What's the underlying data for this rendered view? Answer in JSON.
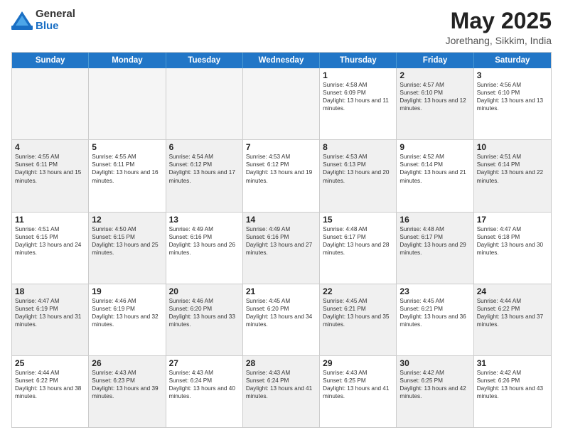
{
  "logo": {
    "general": "General",
    "blue": "Blue"
  },
  "header": {
    "month": "May 2025",
    "location": "Jorethang, Sikkim, India"
  },
  "days_of_week": [
    "Sunday",
    "Monday",
    "Tuesday",
    "Wednesday",
    "Thursday",
    "Friday",
    "Saturday"
  ],
  "weeks": [
    [
      {
        "day": "",
        "empty": true
      },
      {
        "day": "",
        "empty": true
      },
      {
        "day": "",
        "empty": true
      },
      {
        "day": "",
        "empty": true
      },
      {
        "day": "1",
        "sunrise": "Sunrise: 4:58 AM",
        "sunset": "Sunset: 6:09 PM",
        "daylight": "Daylight: 13 hours and 11 minutes."
      },
      {
        "day": "2",
        "sunrise": "Sunrise: 4:57 AM",
        "sunset": "Sunset: 6:10 PM",
        "daylight": "Daylight: 13 hours and 12 minutes.",
        "shaded": true
      },
      {
        "day": "3",
        "sunrise": "Sunrise: 4:56 AM",
        "sunset": "Sunset: 6:10 PM",
        "daylight": "Daylight: 13 hours and 13 minutes."
      }
    ],
    [
      {
        "day": "4",
        "sunrise": "Sunrise: 4:55 AM",
        "sunset": "Sunset: 6:11 PM",
        "daylight": "Daylight: 13 hours and 15 minutes.",
        "shaded": true
      },
      {
        "day": "5",
        "sunrise": "Sunrise: 4:55 AM",
        "sunset": "Sunset: 6:11 PM",
        "daylight": "Daylight: 13 hours and 16 minutes."
      },
      {
        "day": "6",
        "sunrise": "Sunrise: 4:54 AM",
        "sunset": "Sunset: 6:12 PM",
        "daylight": "Daylight: 13 hours and 17 minutes.",
        "shaded": true
      },
      {
        "day": "7",
        "sunrise": "Sunrise: 4:53 AM",
        "sunset": "Sunset: 6:12 PM",
        "daylight": "Daylight: 13 hours and 19 minutes."
      },
      {
        "day": "8",
        "sunrise": "Sunrise: 4:53 AM",
        "sunset": "Sunset: 6:13 PM",
        "daylight": "Daylight: 13 hours and 20 minutes.",
        "shaded": true
      },
      {
        "day": "9",
        "sunrise": "Sunrise: 4:52 AM",
        "sunset": "Sunset: 6:14 PM",
        "daylight": "Daylight: 13 hours and 21 minutes."
      },
      {
        "day": "10",
        "sunrise": "Sunrise: 4:51 AM",
        "sunset": "Sunset: 6:14 PM",
        "daylight": "Daylight: 13 hours and 22 minutes.",
        "shaded": true
      }
    ],
    [
      {
        "day": "11",
        "sunrise": "Sunrise: 4:51 AM",
        "sunset": "Sunset: 6:15 PM",
        "daylight": "Daylight: 13 hours and 24 minutes."
      },
      {
        "day": "12",
        "sunrise": "Sunrise: 4:50 AM",
        "sunset": "Sunset: 6:15 PM",
        "daylight": "Daylight: 13 hours and 25 minutes.",
        "shaded": true
      },
      {
        "day": "13",
        "sunrise": "Sunrise: 4:49 AM",
        "sunset": "Sunset: 6:16 PM",
        "daylight": "Daylight: 13 hours and 26 minutes."
      },
      {
        "day": "14",
        "sunrise": "Sunrise: 4:49 AM",
        "sunset": "Sunset: 6:16 PM",
        "daylight": "Daylight: 13 hours and 27 minutes.",
        "shaded": true
      },
      {
        "day": "15",
        "sunrise": "Sunrise: 4:48 AM",
        "sunset": "Sunset: 6:17 PM",
        "daylight": "Daylight: 13 hours and 28 minutes."
      },
      {
        "day": "16",
        "sunrise": "Sunrise: 4:48 AM",
        "sunset": "Sunset: 6:17 PM",
        "daylight": "Daylight: 13 hours and 29 minutes.",
        "shaded": true
      },
      {
        "day": "17",
        "sunrise": "Sunrise: 4:47 AM",
        "sunset": "Sunset: 6:18 PM",
        "daylight": "Daylight: 13 hours and 30 minutes."
      }
    ],
    [
      {
        "day": "18",
        "sunrise": "Sunrise: 4:47 AM",
        "sunset": "Sunset: 6:19 PM",
        "daylight": "Daylight: 13 hours and 31 minutes.",
        "shaded": true
      },
      {
        "day": "19",
        "sunrise": "Sunrise: 4:46 AM",
        "sunset": "Sunset: 6:19 PM",
        "daylight": "Daylight: 13 hours and 32 minutes."
      },
      {
        "day": "20",
        "sunrise": "Sunrise: 4:46 AM",
        "sunset": "Sunset: 6:20 PM",
        "daylight": "Daylight: 13 hours and 33 minutes.",
        "shaded": true
      },
      {
        "day": "21",
        "sunrise": "Sunrise: 4:45 AM",
        "sunset": "Sunset: 6:20 PM",
        "daylight": "Daylight: 13 hours and 34 minutes."
      },
      {
        "day": "22",
        "sunrise": "Sunrise: 4:45 AM",
        "sunset": "Sunset: 6:21 PM",
        "daylight": "Daylight: 13 hours and 35 minutes.",
        "shaded": true
      },
      {
        "day": "23",
        "sunrise": "Sunrise: 4:45 AM",
        "sunset": "Sunset: 6:21 PM",
        "daylight": "Daylight: 13 hours and 36 minutes."
      },
      {
        "day": "24",
        "sunrise": "Sunrise: 4:44 AM",
        "sunset": "Sunset: 6:22 PM",
        "daylight": "Daylight: 13 hours and 37 minutes.",
        "shaded": true
      }
    ],
    [
      {
        "day": "25",
        "sunrise": "Sunrise: 4:44 AM",
        "sunset": "Sunset: 6:22 PM",
        "daylight": "Daylight: 13 hours and 38 minutes."
      },
      {
        "day": "26",
        "sunrise": "Sunrise: 4:43 AM",
        "sunset": "Sunset: 6:23 PM",
        "daylight": "Daylight: 13 hours and 39 minutes.",
        "shaded": true
      },
      {
        "day": "27",
        "sunrise": "Sunrise: 4:43 AM",
        "sunset": "Sunset: 6:24 PM",
        "daylight": "Daylight: 13 hours and 40 minutes."
      },
      {
        "day": "28",
        "sunrise": "Sunrise: 4:43 AM",
        "sunset": "Sunset: 6:24 PM",
        "daylight": "Daylight: 13 hours and 41 minutes.",
        "shaded": true
      },
      {
        "day": "29",
        "sunrise": "Sunrise: 4:43 AM",
        "sunset": "Sunset: 6:25 PM",
        "daylight": "Daylight: 13 hours and 41 minutes."
      },
      {
        "day": "30",
        "sunrise": "Sunrise: 4:42 AM",
        "sunset": "Sunset: 6:25 PM",
        "daylight": "Daylight: 13 hours and 42 minutes.",
        "shaded": true
      },
      {
        "day": "31",
        "sunrise": "Sunrise: 4:42 AM",
        "sunset": "Sunset: 6:26 PM",
        "daylight": "Daylight: 13 hours and 43 minutes."
      }
    ]
  ]
}
